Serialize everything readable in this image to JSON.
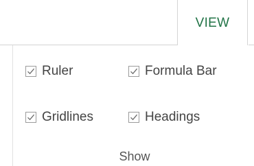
{
  "ribbon": {
    "active_tab": "VIEW",
    "accent_color": "#217346"
  },
  "show_group": {
    "label": "Show",
    "items": [
      {
        "label": "Ruler",
        "checked": true
      },
      {
        "label": "Formula Bar",
        "checked": true
      },
      {
        "label": "Gridlines",
        "checked": true
      },
      {
        "label": "Headings",
        "checked": true
      }
    ]
  }
}
